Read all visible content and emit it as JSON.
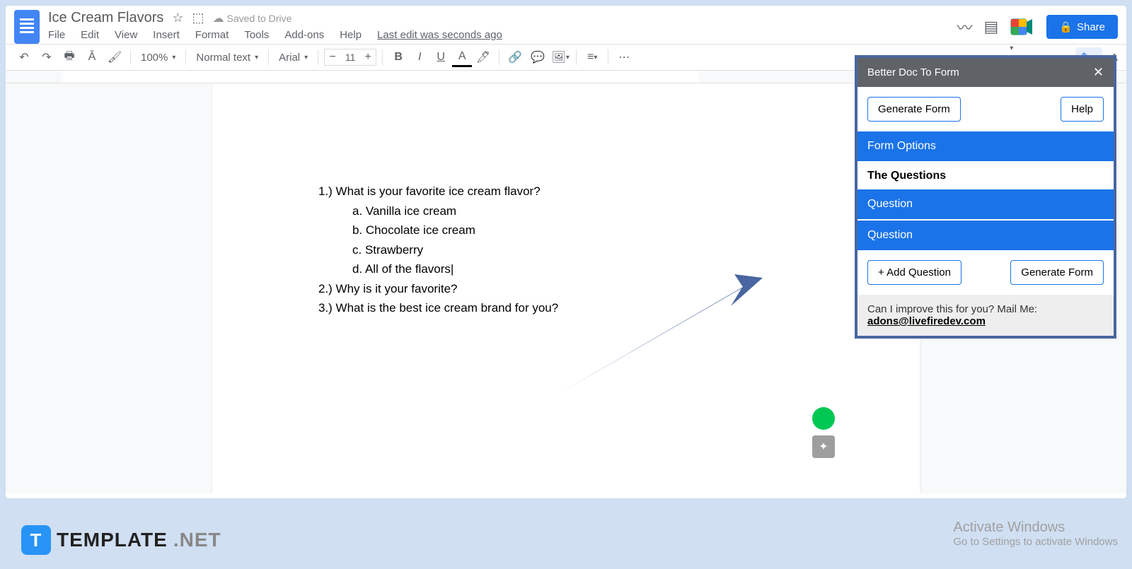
{
  "header": {
    "doc_title": "Ice Cream Flavors",
    "saved_text": "Saved to Drive",
    "menu": [
      "File",
      "Edit",
      "View",
      "Insert",
      "Format",
      "Tools",
      "Add-ons",
      "Help"
    ],
    "last_edit": "Last edit was seconds ago",
    "share_label": "Share"
  },
  "toolbar": {
    "zoom": "100%",
    "style": "Normal text",
    "font": "Arial",
    "font_size": "11"
  },
  "document": {
    "q1": "1.)  What is your favorite ice cream flavor?",
    "q1_opts": [
      "a.   Vanilla ice cream",
      "b.   Chocolate ice cream",
      "c.   Strawberry",
      "d.   All of the flavors"
    ],
    "q2": "2.)  Why is it your favorite?",
    "q3": "3.)  What is the best ice cream brand for you?"
  },
  "sidebar": {
    "title": "Better Doc To Form",
    "generate_btn": "Generate Form",
    "help_btn": "Help",
    "form_options": "Form Options",
    "the_questions": "The Questions",
    "question_label": "Question",
    "add_question": "+ Add Question",
    "generate_form2": "Generate Form",
    "footer_text": "Can I improve this for you? Mail Me:",
    "footer_email": "adons@livefiredev.com"
  },
  "watermark": {
    "brand": "TEMPLATE",
    "net": ".NET"
  },
  "windows": {
    "title": "Activate Windows",
    "sub": "Go to Settings to activate Windows"
  }
}
